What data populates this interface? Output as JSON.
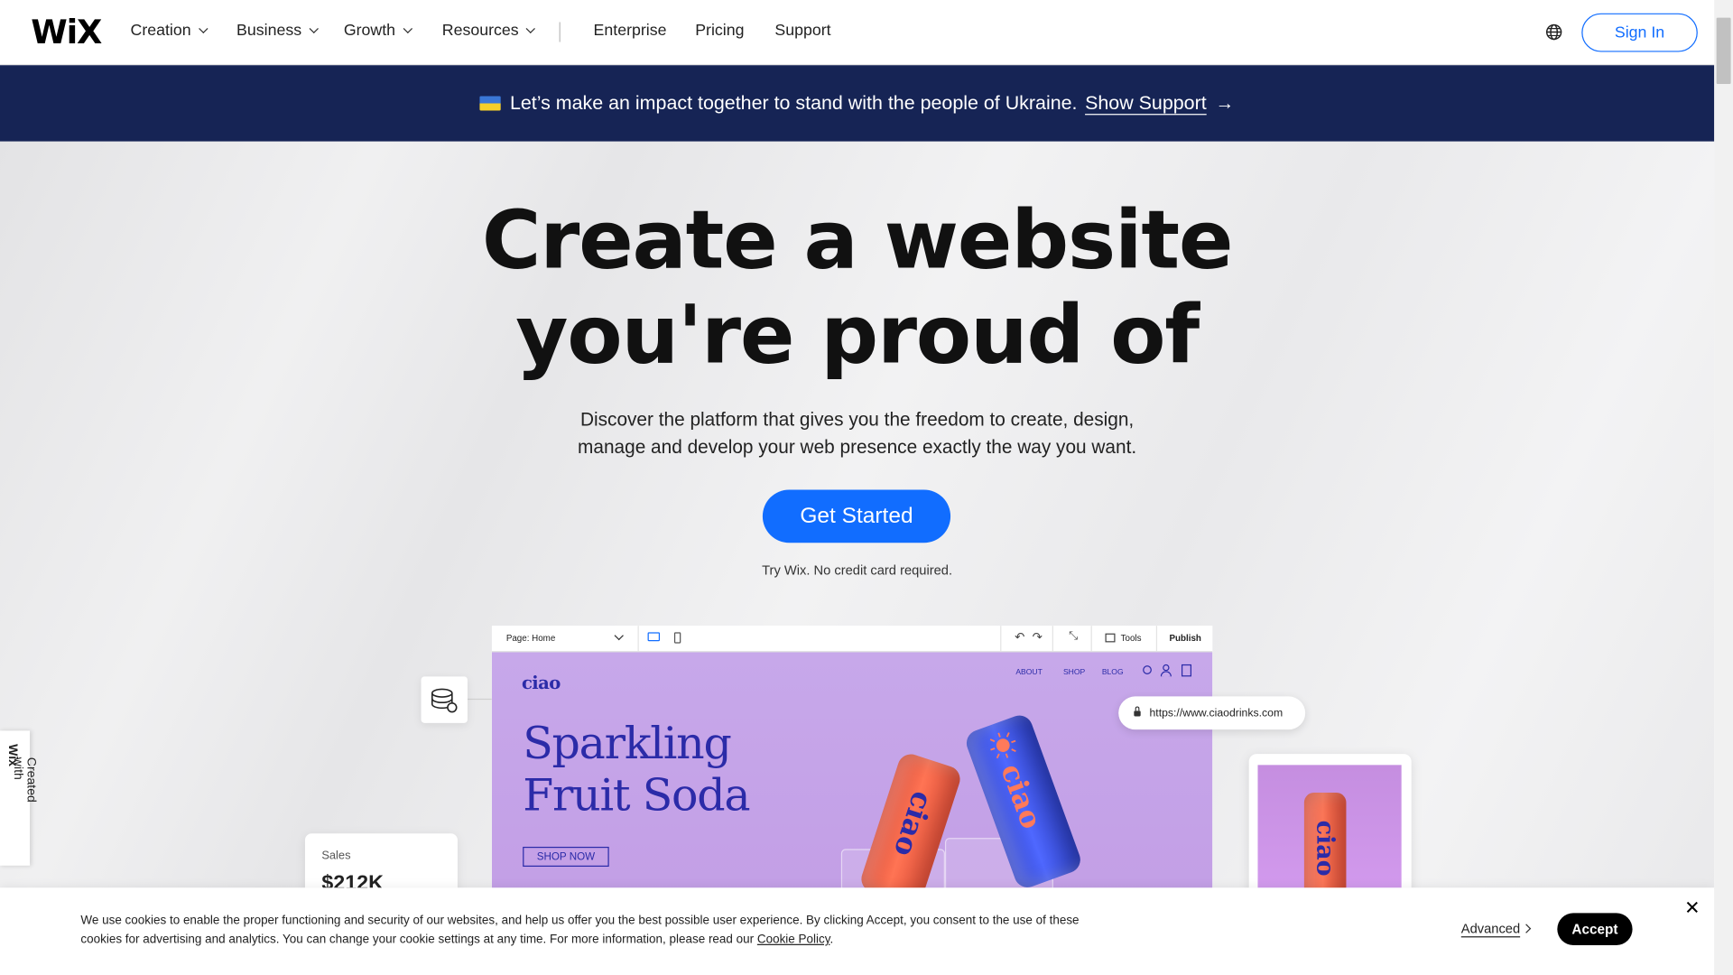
{
  "header": {
    "logo": "WiX",
    "nav": [
      {
        "label": "Creation",
        "dropdown": true
      },
      {
        "label": "Business",
        "dropdown": true
      },
      {
        "label": "Growth",
        "dropdown": true
      },
      {
        "label": "Resources",
        "dropdown": true
      },
      {
        "label": "Enterprise",
        "dropdown": false
      },
      {
        "label": "Pricing",
        "dropdown": false
      },
      {
        "label": "Support",
        "dropdown": false
      }
    ],
    "globe_icon": "globe-icon",
    "sign_in": "Sign In"
  },
  "banner": {
    "text": "Let’s make an impact together to stand with the people of Ukraine.",
    "link": "Show Support",
    "arrow": "→",
    "flag_icon": "ukraine-flag-icon"
  },
  "hero": {
    "title_line1": "Create a website",
    "title_line2": "you're proud of",
    "subtitle_line1": "Discover the platform that gives you the freedom to create, design,",
    "subtitle_line2": "manage and develop your web presence exactly the way you want.",
    "cta": "Get Started",
    "note": "Try Wix. No credit card required."
  },
  "editor": {
    "page_select": "Page: Home",
    "tools": "Tools",
    "publish": "Publish",
    "site": {
      "logo": "ciao",
      "nav": [
        "ABOUT",
        "SHOP",
        "BLOG"
      ],
      "headline_line1": "Sparkling",
      "headline_line2": "Fruit Soda",
      "button": "SHOP NOW",
      "can_label": "ciao"
    },
    "url": "https://www.ciaodrinks.com"
  },
  "widgets": {
    "sales_label": "Sales",
    "sales_value": "$212K"
  },
  "side_tab": {
    "text_prefix": "Created with ",
    "text_brand": "Wix"
  },
  "cookie": {
    "text": "We use cookies to enable the proper functioning and security of our websites, and help us offer you the best possible user experience. By clicking Accept, you consent to the use of these cookies for advertising and analytics. You can change your cookie settings at any time. For more information, please read our ",
    "link": "Cookie Policy",
    "suffix": ".",
    "advanced": "Advanced",
    "accept": "Accept",
    "close": "✕"
  },
  "colors": {
    "brand_blue": "#116dff",
    "banner_navy": "#162455",
    "site_purple": "#c7a8ea",
    "site_ink": "#2b2ba8"
  }
}
